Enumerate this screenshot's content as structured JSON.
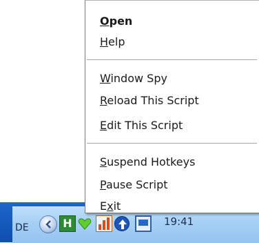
{
  "tray": {
    "language": "DE",
    "clock_text": "19:41",
    "icons": [
      "collapse-chevron-icon",
      "autohotkey-icon",
      "heart-icon",
      "meter-icon",
      "network-icon",
      "monitor-icon"
    ]
  },
  "menu": {
    "items": [
      {
        "mnemonic": "O",
        "rest": "pen",
        "default": true
      },
      {
        "mnemonic": "H",
        "rest": "elp"
      },
      {
        "mnemonic": "W",
        "rest": "indow Spy"
      },
      {
        "mnemonic": "R",
        "rest": "eload This Script"
      },
      {
        "mnemonic": "E",
        "rest": "dit This Script"
      },
      {
        "mnemonic": "S",
        "rest": "uspend Hotkeys"
      },
      {
        "mnemonic": "P",
        "rest": "ause Script"
      },
      {
        "pre": "E",
        "mnemonic": "x",
        "rest": "it"
      }
    ]
  },
  "colors": {
    "taskbar_blue": "#1f66c9",
    "tray_light_blue": "#a8d1f5"
  }
}
